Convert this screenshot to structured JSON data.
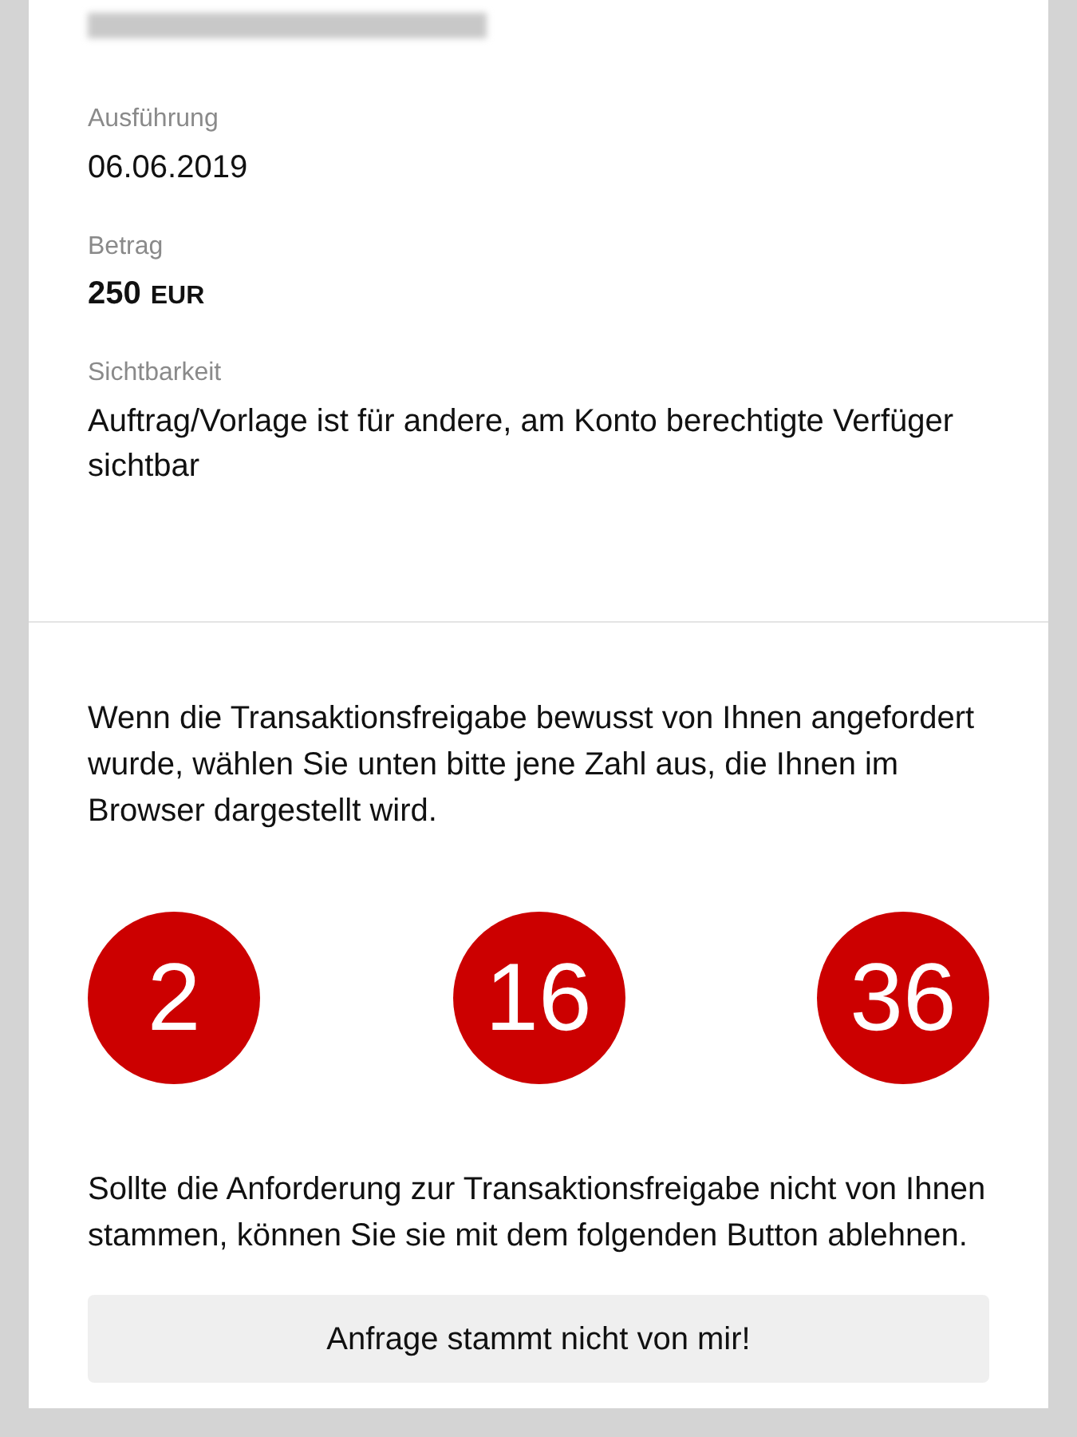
{
  "details": [
    {
      "label": "Ausführung",
      "value": "06.06.2019",
      "kind": "text"
    },
    {
      "label": "Betrag",
      "value": "250",
      "unit": "EUR",
      "kind": "amount"
    },
    {
      "label": "Sichtbarkeit",
      "value": "Auftrag/Vorlage ist für andere, am Konto berechtigte Verfüger sichtbar",
      "kind": "text"
    }
  ],
  "instruction": "Wenn die Transaktionsfreigabe bewusst von Ihnen angefordert wurde, wählen Sie unten bitte jene Zahl aus, die Ihnen im Browser dargestellt wird.",
  "numbers": [
    "2",
    "16",
    "36"
  ],
  "reject_hint": "Sollte die Anforderung zur Transaktionsfreigabe nicht von Ihnen stammen, können Sie sie mit dem folgenden Button ablehnen.",
  "reject_button": "Anfrage stammt nicht von mir!"
}
